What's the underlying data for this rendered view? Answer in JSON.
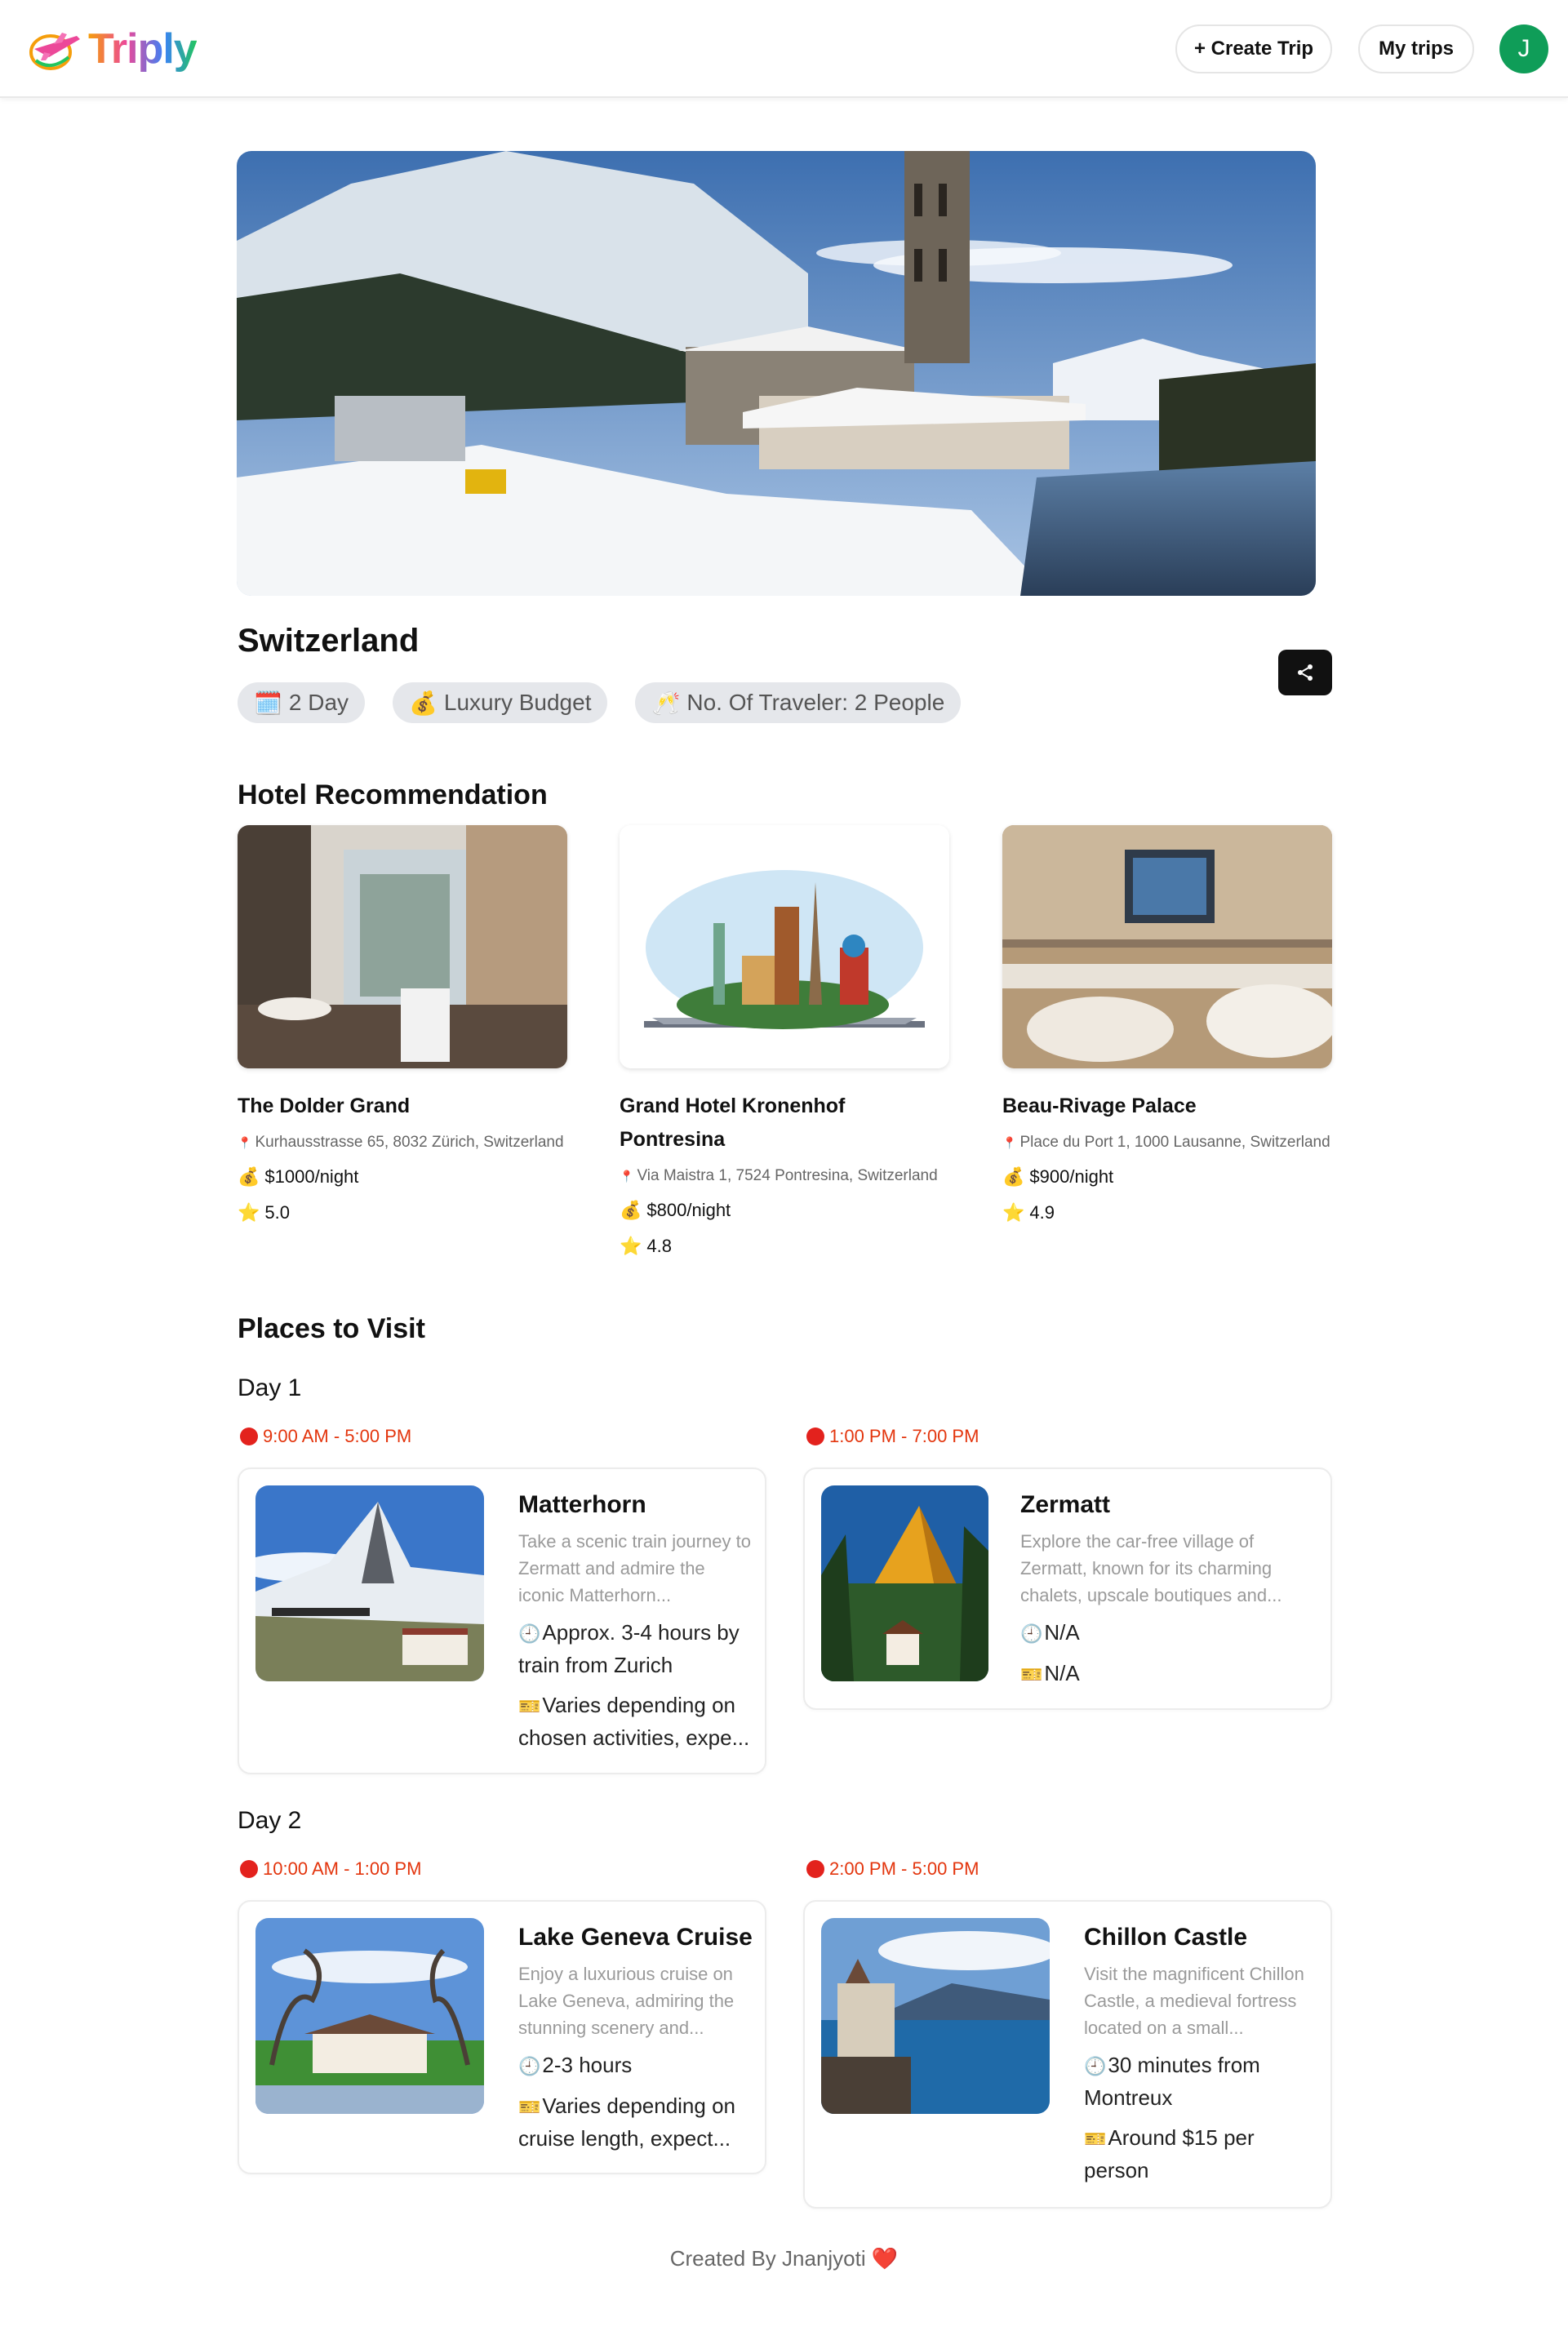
{
  "header": {
    "logo_text": "Triply",
    "create_trip": "+ Create Trip",
    "my_trips": "My trips",
    "avatar_initial": "J"
  },
  "trip": {
    "destination": "Switzerland",
    "days": "2 Day",
    "budget": "Luxury Budget",
    "travelers": "No. Of Traveler: 2 People"
  },
  "hotels_section": {
    "title": "Hotel Recommendation",
    "hotels": [
      {
        "name": "The Dolder Grand",
        "address": "Kurhausstrasse 65, 8032 Zürich, Switzerland",
        "price": "$1000/night",
        "rating": "5.0"
      },
      {
        "name": "Grand Hotel Kronenhof Pontresina",
        "address": "Via Maistra 1, 7524 Pontresina, Switzerland",
        "price": "$800/night",
        "rating": "4.8"
      },
      {
        "name": "Beau-Rivage Palace",
        "address": "Place du Port 1, 1000 Lausanne, Switzerland",
        "price": "$900/night",
        "rating": "4.9"
      }
    ]
  },
  "places_section": {
    "title": "Places to Visit",
    "days": [
      {
        "label": "Day 1",
        "places": [
          {
            "time": "9:00 AM - 5:00 PM",
            "name": "Matterhorn",
            "description": "Take a scenic train journey to Zermatt and admire the iconic Matterhorn...",
            "duration": "Approx. 3-4 hours by train from Zurich",
            "ticket": "Varies depending on chosen activities, expe..."
          },
          {
            "time": "1:00 PM - 7:00 PM",
            "name": "Zermatt",
            "description": "Explore the car-free village of Zermatt, known for its charming chalets, upscale boutiques and...",
            "duration": "N/A",
            "ticket": "N/A"
          }
        ]
      },
      {
        "label": "Day 2",
        "places": [
          {
            "time": "10:00 AM - 1:00 PM",
            "name": "Lake Geneva Cruise",
            "description": "Enjoy a luxurious cruise on Lake Geneva, admiring the stunning scenery and...",
            "duration": "2-3 hours",
            "ticket": "Varies depending on cruise length, expect..."
          },
          {
            "time": "2:00 PM - 5:00 PM",
            "name": "Chillon Castle",
            "description": "Visit the magnificent Chillon Castle, a medieval fortress located on a small...",
            "duration": "30 minutes from Montreux",
            "ticket": "Around $15 per person"
          }
        ]
      }
    ]
  },
  "footer": {
    "text": "Created By Jnanjyoti"
  },
  "icons": {
    "calendar": "🗓️",
    "money_bag": "💰",
    "travelers": "🥂",
    "pin": "📍",
    "star": "⭐",
    "clock": "🕘",
    "ticket": "🎫",
    "heart": "❤️"
  },
  "colors": {
    "accent_red": "#e3350d",
    "avatar_green": "#0f9d58",
    "chip_bg": "#e5e7eb"
  }
}
